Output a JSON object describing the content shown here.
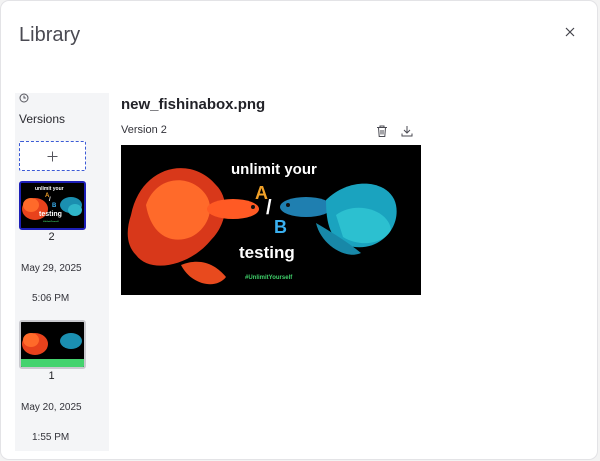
{
  "dialog": {
    "title": "Library",
    "close_icon": "close-icon"
  },
  "sidebar": {
    "versions_label": "Versions",
    "add_icon": "plus-icon",
    "items": [
      {
        "number": "2",
        "date": "May 29, 2025",
        "time": "5:06 PM",
        "selected": true
      },
      {
        "number": "1",
        "date": "May 20, 2025",
        "time": "1:55 PM",
        "selected": false
      }
    ]
  },
  "main": {
    "filename": "new_fishinabox.png",
    "version_label": "Version 2",
    "delete_icon": "trash-icon",
    "download_icon": "download-icon",
    "preview": {
      "line1": "unlimit your",
      "a": "A",
      "slash": "/",
      "b": "B",
      "line2": "testing",
      "hashtag": "#UnlimitYourself"
    }
  },
  "colors": {
    "accent": "#1d1fb8",
    "dashed_border": "#3c5bd6",
    "orange": "#f0a028",
    "blue": "#3ab0f0",
    "green": "#3fd06a"
  }
}
